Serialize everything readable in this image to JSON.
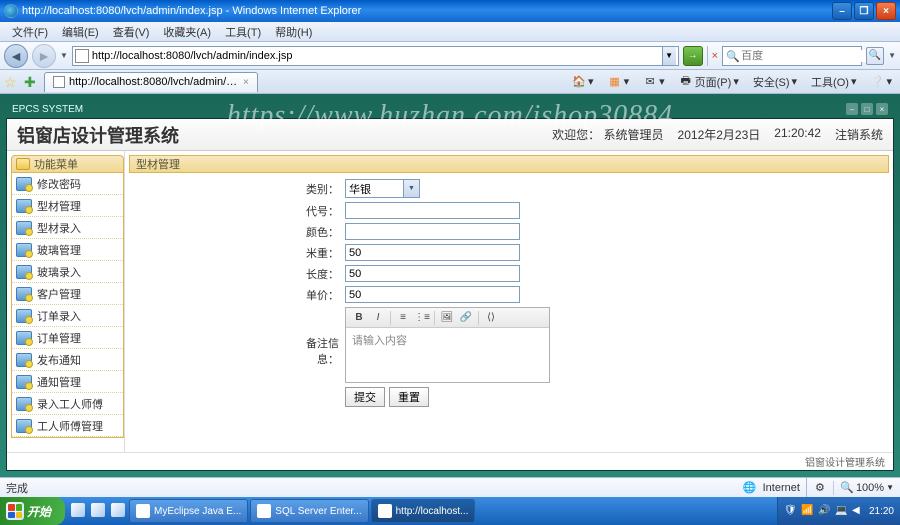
{
  "window": {
    "title": "http://localhost:8080/lvch/admin/index.jsp - Windows Internet Explorer",
    "min": "–",
    "max": "❐",
    "close": "×"
  },
  "menu": [
    "文件(F)",
    "编辑(E)",
    "查看(V)",
    "收藏夹(A)",
    "工具(T)",
    "帮助(H)"
  ],
  "nav": {
    "back": "◄",
    "fwd": "►",
    "url": "http://localhost:8080/lvch/admin/index.jsp",
    "go": "→",
    "refresh": "↻",
    "stop": "×",
    "search_placeholder": "百度",
    "search_go": "🔍"
  },
  "tabs": {
    "fav1": "☆",
    "fav2": "✚",
    "tab_label": "http://localhost:8080/lvch/admin/index.jsp",
    "right": {
      "home": "🏠",
      "print": "🖶",
      "page": "页面(P)",
      "safety": "安全(S)",
      "tools": "工具(O)",
      "help": "❔"
    }
  },
  "app": {
    "system_label": "EPCS SYSTEM",
    "title": "铝窗店设计管理系统",
    "welcome": "欢迎您：",
    "user": "系统管理员",
    "date": "2012年2月23日",
    "time": "21:20:42",
    "logout": "注销系统",
    "footer": "铝窗设计管理系统"
  },
  "sidebar": {
    "header": "功能菜单",
    "items": [
      "修改密码",
      "型材管理",
      "型材录入",
      "玻璃管理",
      "玻璃录入",
      "客户管理",
      "订单录入",
      "订单管理",
      "发布通知",
      "通知管理",
      "录入工人师傅",
      "工人师傅管理"
    ]
  },
  "form": {
    "header": "型材管理",
    "rows": {
      "category": {
        "label": "类别：",
        "value": "华银"
      },
      "code": {
        "label": "代号：",
        "value": ""
      },
      "color": {
        "label": "颜色：",
        "value": ""
      },
      "meter": {
        "label": "米重：",
        "value": "50"
      },
      "length": {
        "label": "长度：",
        "value": "50"
      },
      "unitprice": {
        "label": "单价：",
        "value": "50"
      },
      "remark": {
        "label": "备注信息：",
        "placeholder": "请输入内容"
      }
    },
    "editor_btns": {
      "bold": "B",
      "italic": "I",
      "ol": "≡",
      "ul": "⋮≡",
      "img": "🖼",
      "link": "🔗",
      "code": "⟨⟩"
    },
    "submit": "提交",
    "reset": "重置"
  },
  "status": {
    "done": "完成",
    "internet": "Internet",
    "zoom": "100%"
  },
  "taskbar": {
    "start": "开始",
    "items": [
      {
        "label": "MyEclipse Java E...",
        "active": false
      },
      {
        "label": "SQL Server Enter...",
        "active": false
      },
      {
        "label": "http://localhost...",
        "active": true
      }
    ],
    "clock": "21:20"
  },
  "watermark": "https://www.huzhan.com/ishop30884"
}
